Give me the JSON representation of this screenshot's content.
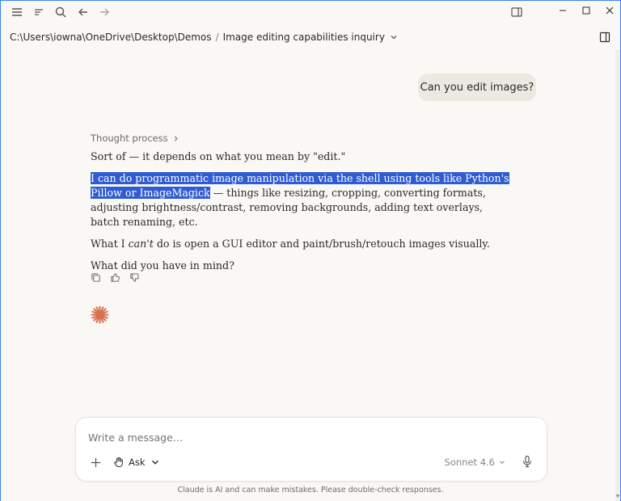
{
  "titlebar": {
    "icons": [
      "menu-icon",
      "sidebar-list-icon",
      "search-icon",
      "back-arrow-icon",
      "forward-arrow-icon",
      "panel-layout-icon"
    ],
    "window_controls": [
      "minimize-icon",
      "maximize-icon",
      "close-icon"
    ]
  },
  "breadcrumb": {
    "path": "C:\\Users\\iowna\\OneDrive\\Desktop\\Demos",
    "separator": "/",
    "chat_title": "Image editing capabilities inquiry"
  },
  "conversation": {
    "user_message": "Can you edit images?",
    "thought_label": "Thought process",
    "p1": "Sort of — it depends on what you mean by \"edit.\"",
    "p2_highlighted": "I can do programmatic image manipulation via the shell using tools like Python's Pillow or ImageMagick",
    "p2_rest": " — things like resizing, cropping, converting formats, adjusting brightness/contrast, removing backgrounds, adding text overlays, batch renaming, etc.",
    "p3_before": "What I ",
    "p3_em": "can't",
    "p3_after": " do is open a GUI editor and paint/brush/retouch images visually.",
    "p4": "What did you have in mind?"
  },
  "composer": {
    "placeholder": "Write a message…",
    "ask_label": "Ask",
    "model_label": "Sonnet 4.6"
  },
  "disclaimer": "Claude is AI and can make mistakes. Please double-check responses.",
  "colors": {
    "background": "#f9f8f5",
    "user_bubble": "#ebe9e2",
    "highlight": "#2f5bd3",
    "accent_spark": "#d9704f"
  }
}
